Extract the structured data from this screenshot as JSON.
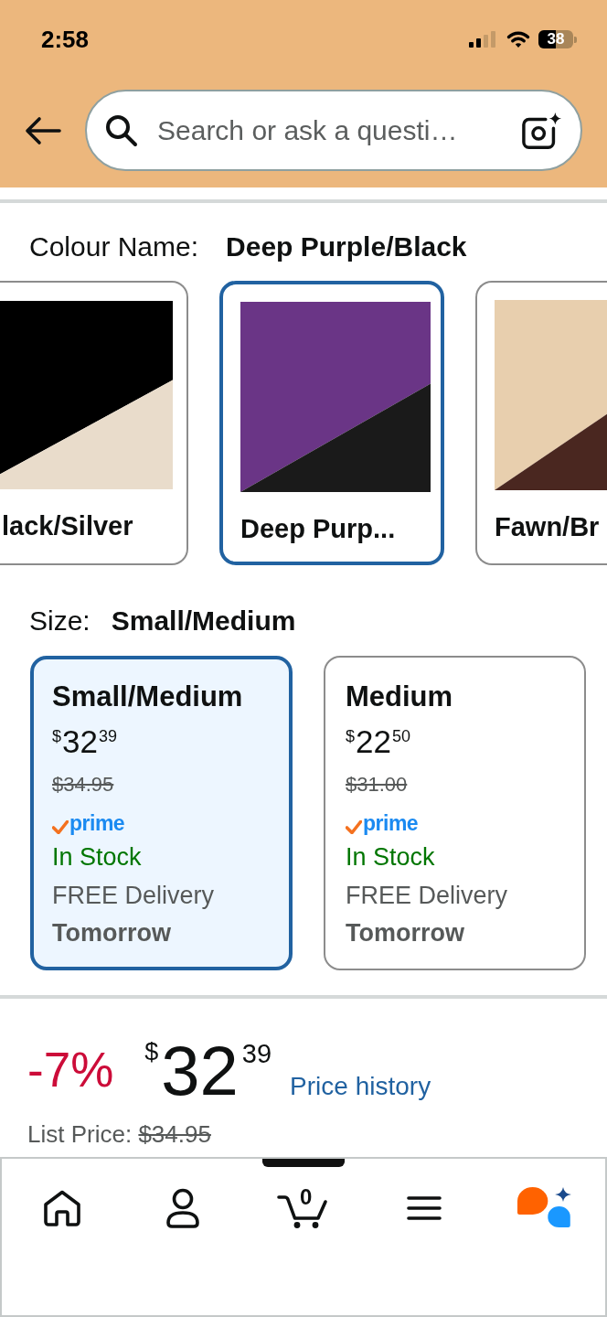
{
  "status_bar": {
    "time": "2:58",
    "battery": "38"
  },
  "search": {
    "placeholder": "Search or ask a questi…"
  },
  "colour": {
    "label": "Colour Name:",
    "value": "Deep Purple/Black",
    "options": [
      {
        "label": "lack/Silver",
        "selected": false,
        "swatch_parts": [
          {
            "color": "#000000"
          },
          {
            "color": "#e9dccb"
          }
        ]
      },
      {
        "label": "Deep Purp...",
        "selected": true,
        "swatch_parts": [
          {
            "color": "#6a3586"
          },
          {
            "color": "#1a1a1a"
          }
        ]
      },
      {
        "label": "Fawn/Br",
        "selected": false,
        "swatch_parts": [
          {
            "color": "#e8cfae"
          },
          {
            "color": "#4a2720"
          }
        ]
      }
    ]
  },
  "size": {
    "label": "Size:",
    "value": "Small/Medium",
    "options": [
      {
        "name": "Small/Medium",
        "selected": true,
        "price": {
          "currency": "$",
          "whole": "32",
          "fraction": "39"
        },
        "list_price": "$34.95",
        "badge": "prime",
        "stock": "In Stock",
        "delivery": "FREE Delivery",
        "delivery_day": "Tomorrow"
      },
      {
        "name": "Medium",
        "selected": false,
        "price": {
          "currency": "$",
          "whole": "22",
          "fraction": "50"
        },
        "list_price": "$31.00",
        "badge": "prime",
        "stock": "In Stock",
        "delivery": "FREE Delivery",
        "delivery_day": "Tomorrow"
      }
    ]
  },
  "price": {
    "discount": "-7%",
    "currency": "$",
    "whole": "32",
    "fraction": "39",
    "history_link": "Price history",
    "list_price_label": "List Price:",
    "list_price": "$34.95"
  },
  "bottom_nav": {
    "items": [
      {
        "kind": "home"
      },
      {
        "kind": "account"
      },
      {
        "kind": "cart",
        "count": "0"
      },
      {
        "kind": "menu"
      },
      {
        "kind": "assistant"
      }
    ]
  }
}
